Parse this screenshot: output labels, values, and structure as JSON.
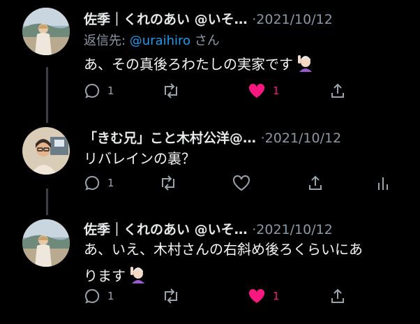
{
  "tweets": [
    {
      "display_name": "佐季｜くれのあい @いそ…",
      "date": "·2021/10/12",
      "reply_prefix": "返信先: ",
      "reply_mention": "@uraihiro",
      "reply_suffix": " さん",
      "text": "あ、その真後ろわたしの実家です",
      "emoji": "person-raising-hand-emoji",
      "reply_count": "1",
      "like_count": "1",
      "liked": true
    },
    {
      "display_name": "「きむ兄」こと木村公洋@…",
      "date": "·2021/10/12",
      "text": "リバレインの裏？",
      "reply_count": "1",
      "liked": false
    },
    {
      "display_name": "佐季｜くれのあい @いそ…",
      "date": "·2021/10/12",
      "text_line1": "あ、いえ、木村さんの右斜め後ろくらいにあ",
      "text_line2": "ります",
      "emoji": "person-raising-hand-emoji",
      "reply_count": "1",
      "like_count": "1",
      "liked": true
    }
  ],
  "colors": {
    "background": "#000000",
    "text": "#e7e9ea",
    "muted": "#8b98a5",
    "link": "#1d9bf0",
    "like": "#f91880"
  }
}
